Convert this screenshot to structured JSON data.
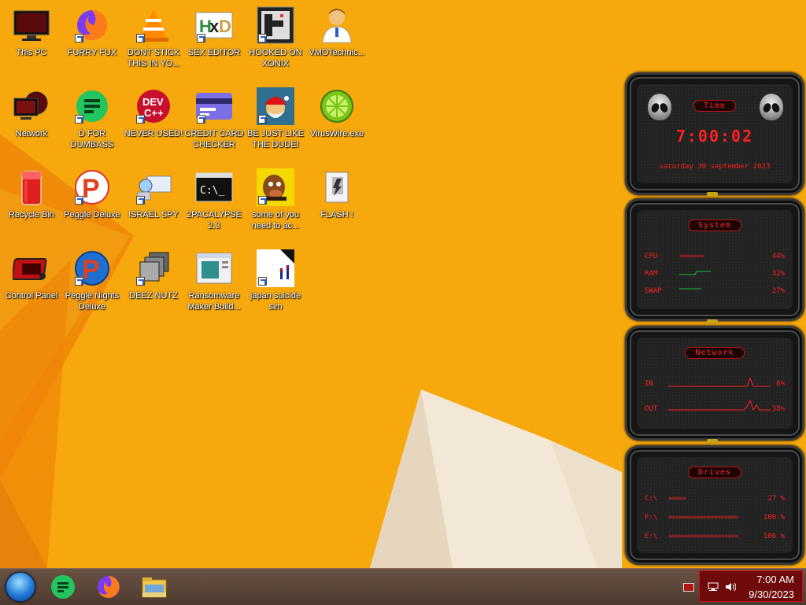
{
  "desktop": {
    "icons": [
      {
        "label": "This PC",
        "icon": "monitor-icon"
      },
      {
        "label": "FURRY FUX",
        "icon": "firefox-icon"
      },
      {
        "label": "DONT STICK THIS IN YO...",
        "icon": "vlc-cone-icon"
      },
      {
        "label": "SEX EDITOR",
        "icon": "hxd-icon"
      },
      {
        "label": "HOOKED ON XONIX",
        "icon": "xonix-game-icon"
      },
      {
        "label": "VMOTechnic...",
        "icon": "doctor-person-icon"
      },
      {
        "label": "Network",
        "icon": "network-icon"
      },
      {
        "label": "D FOR DUMBASS",
        "icon": "document-app-icon"
      },
      {
        "label": "NEVER USED!",
        "icon": "dev-cpp-icon"
      },
      {
        "label": "CREDIT CARD CHECKER",
        "icon": "credit-card-icon"
      },
      {
        "label": "BE JUST LIKE THE DUDE!",
        "icon": "santa-dude-icon"
      },
      {
        "label": "VirusWire.exe",
        "icon": "lime-icon"
      },
      {
        "label": "Recycle Bin",
        "icon": "recycle-bin-icon"
      },
      {
        "label": "Peggle Deluxe",
        "icon": "peggle-icon"
      },
      {
        "label": "ISRAEL SPY",
        "icon": "spy-computer-icon"
      },
      {
        "label": "2PACALYPSE 2.3",
        "icon": "console-window-icon"
      },
      {
        "label": "some of you need to ac...",
        "icon": "cartoon-dog-icon"
      },
      {
        "label": "FLASH !",
        "icon": "flash-document-icon"
      },
      {
        "label": "Control Panel",
        "icon": "control-panel-icon"
      },
      {
        "label": "Peggle Nights Deluxe",
        "icon": "peggle-nights-icon"
      },
      {
        "label": "DEEZ NUTZ",
        "icon": "stacked-windows-icon"
      },
      {
        "label": "Ransomware Maker Build...",
        "icon": "ransomware-builder-icon"
      },
      {
        "label": "japan suicide sim",
        "icon": "japan-sim-icon"
      }
    ]
  },
  "gadget": {
    "time": {
      "title": "Time",
      "clock": "7:00:02",
      "date": "saturday 30 september 2023"
    },
    "system": {
      "title": "System",
      "rows": [
        {
          "label": "CPU",
          "value": "44%",
          "chevrons": "»»»»»»»"
        },
        {
          "label": "RAM",
          "value": "32%",
          "chevrons": ""
        },
        {
          "label": "SWAP",
          "value": "27%",
          "chevrons": ""
        }
      ]
    },
    "network": {
      "title": "Network",
      "rows": [
        {
          "label": "IN",
          "value": "6%"
        },
        {
          "label": "OUT",
          "value": "38%"
        }
      ]
    },
    "drives": {
      "title": "Drives",
      "rows": [
        {
          "label": "C:\\",
          "value": "27 %",
          "chevrons": "»»»»»",
          "level": 0.27
        },
        {
          "label": "F:\\",
          "value": "100 %",
          "chevrons": "»»»»»»»»»»»»»»»»»»»»",
          "level": 1.0
        },
        {
          "label": "E:\\",
          "value": "100 %",
          "chevrons": "»»»»»»»»»»»»»»»»»»»»",
          "level": 1.0
        }
      ]
    }
  },
  "taskbar": {
    "pinned": [
      {
        "name": "start-orb-icon"
      },
      {
        "name": "document-app-icon"
      },
      {
        "name": "firefox-icon"
      },
      {
        "name": "file-explorer-icon"
      }
    ],
    "clock": {
      "time": "7:00 AM",
      "date": "9/30/2023"
    },
    "tray_icons": [
      "network-tray-icon",
      "volume-icon"
    ]
  },
  "colors": {
    "wallpaper": "#f6a20b",
    "gadget_accent": "#ff2020",
    "tray_bg": "#6e0a0a"
  }
}
